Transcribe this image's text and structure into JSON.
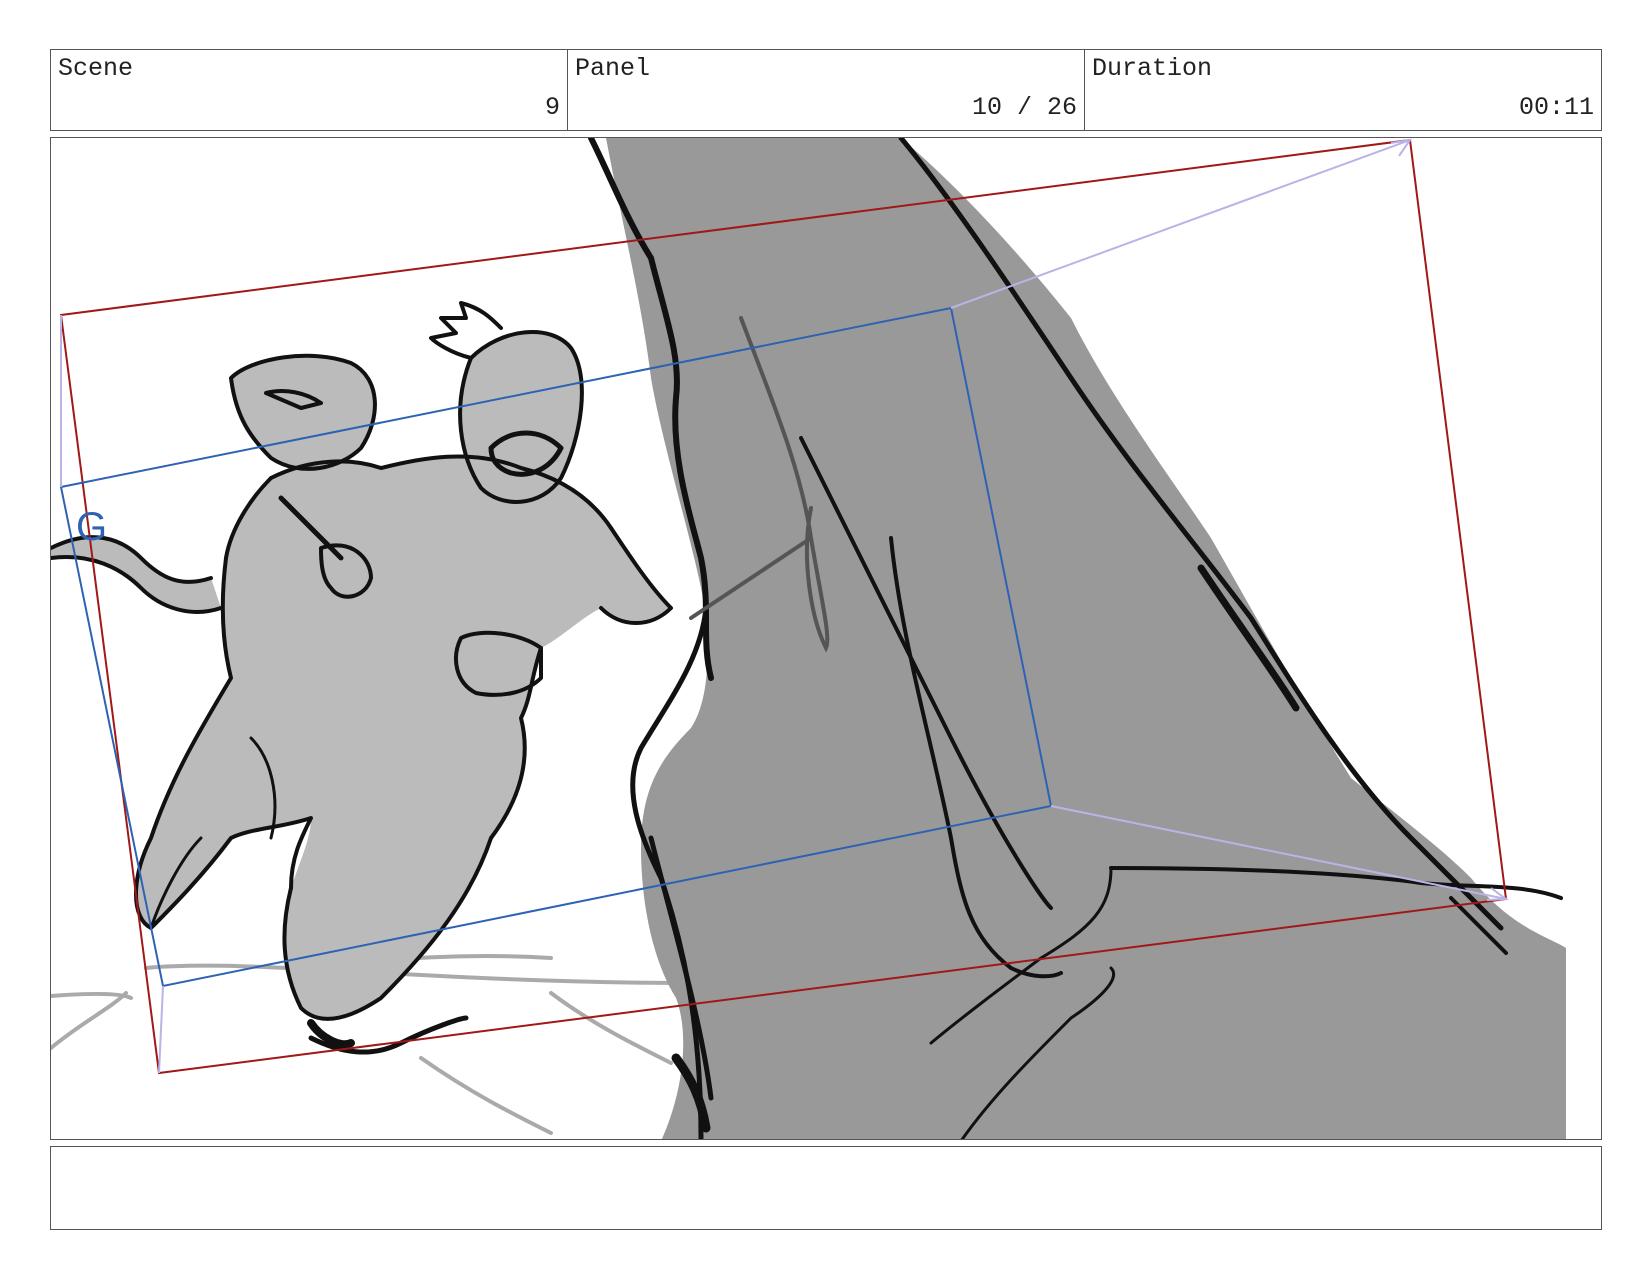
{
  "header": {
    "scene_label": "Scene",
    "scene_value": "9",
    "panel_label": "Panel",
    "panel_value": "10 / 26",
    "duration_label": "Duration",
    "duration_value": "00:11"
  },
  "frame": {
    "guide_marker": "G",
    "safe_frame_color": "#a01818",
    "camera_frame_color": "#2e62b3",
    "move_arrow_color": "#b9b4e6",
    "fill_color": "#999999",
    "figure_fill_color": "#bbbbbb"
  },
  "notes": {
    "text": ""
  }
}
